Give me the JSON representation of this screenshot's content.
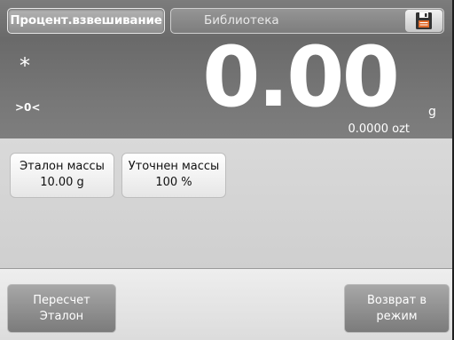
{
  "topbar": {
    "mode_label": "Процент.взвешивание",
    "library_label": "Библиотека",
    "save_icon": "floppy-disk-icon"
  },
  "display": {
    "stability_indicator": "*",
    "zero_indicator": ">0<",
    "main_value": "0.00",
    "main_unit": "g",
    "secondary_value": "0.0000 ozt"
  },
  "cards": [
    {
      "line1": "Эталон массы",
      "line2": "10.00 g"
    },
    {
      "line1": "Уточнен массы",
      "line2": "100 %"
    }
  ],
  "buttons": {
    "recalc_line1": "Пересчет",
    "recalc_line2": "Эталон",
    "return_line1": "Возврат в",
    "return_line2": "режим"
  },
  "colors": {
    "topbar": "#707070",
    "display": "#747474",
    "middle": "#d5d5d5",
    "button": "#8f8f8f"
  }
}
